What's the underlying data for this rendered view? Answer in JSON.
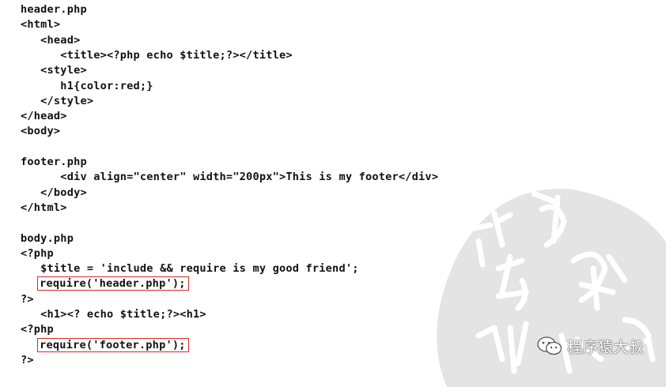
{
  "code_lines": [
    "header.php",
    "<html>",
    "   <head>",
    "      <title><?php echo $title;?></title>",
    "   <style>",
    "      h1{color:red;}",
    "   </style>",
    "</head>",
    "<body>",
    "",
    "footer.php",
    "      <div align=\"center\" width=\"200px\">This is my footer</div>",
    "   </body>",
    "</html>",
    "",
    "body.php",
    "<?php",
    "   $title = 'include && require is my good friend';",
    "   require('header.php');",
    "?>",
    "   <h1><? echo $title;?><h1>",
    "<?php",
    "   require('footer.php');",
    "?>"
  ],
  "highlighted_lines": [
    18,
    22
  ],
  "highlight_color": "#d62a2a",
  "watermark": {
    "brand_text": "程序猿大叔",
    "brand_icon": "wechat-icon",
    "seal_text": "讀乎邪 教我"
  }
}
